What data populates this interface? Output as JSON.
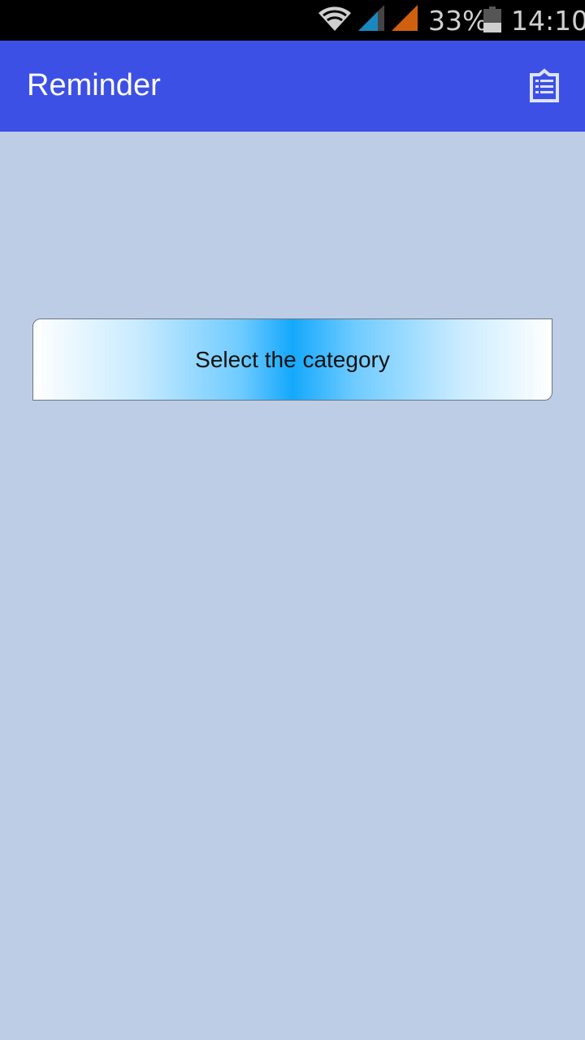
{
  "status_bar": {
    "battery_percent": "33%",
    "time": "14:10",
    "icons": [
      "wifi-icon",
      "signal-icon-sim1",
      "signal-icon-sim2",
      "battery-icon"
    ]
  },
  "app_bar": {
    "title": "Reminder",
    "action_icon": "clipboard-list-icon"
  },
  "main": {
    "select_category_label": "Select the category"
  },
  "colors": {
    "app_bar": "#3D50E5",
    "background": "#BDCDE6",
    "button_accent": "#14A8FC"
  }
}
